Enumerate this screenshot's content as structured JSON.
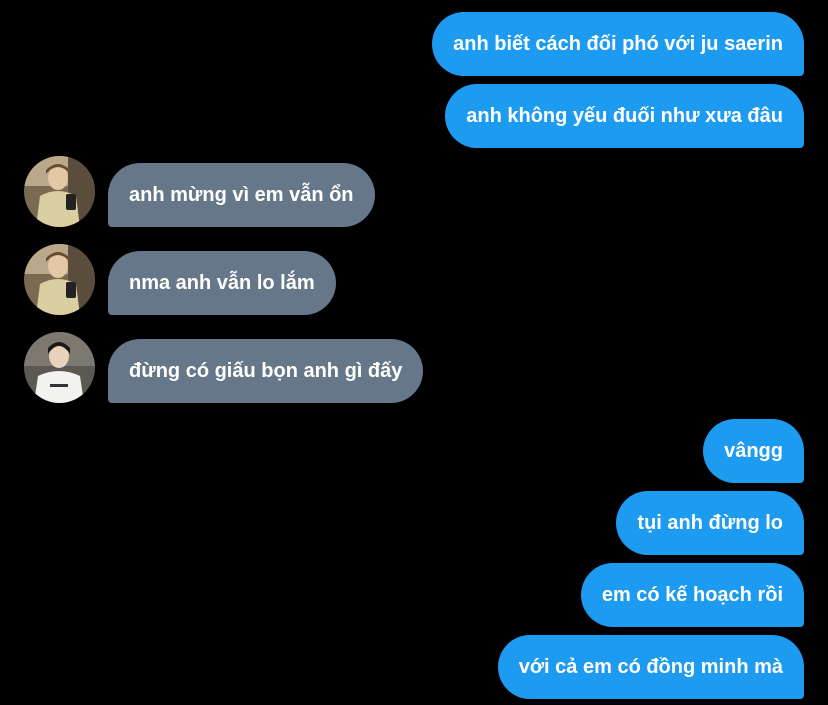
{
  "messages": [
    {
      "text": "anh biết cách đối phó với ju saerin",
      "direction": "outgoing"
    },
    {
      "text": "anh không yếu đuối như xưa đâu",
      "direction": "outgoing"
    },
    {
      "text": "anh mừng vì em vẫn ổn",
      "direction": "incoming",
      "avatar": "avatar-photo-1"
    },
    {
      "text": "nma anh vẫn lo lắm",
      "direction": "incoming",
      "avatar": "avatar-photo-1"
    },
    {
      "text": "đừng có giấu bọn anh gì đấy",
      "direction": "incoming",
      "avatar": "avatar-photo-2"
    },
    {
      "text": "vângg",
      "direction": "outgoing"
    },
    {
      "text": "tụi anh đừng lo",
      "direction": "outgoing"
    },
    {
      "text": "em có kế hoạch rồi",
      "direction": "outgoing"
    },
    {
      "text": "với cả em có đồng minh mà",
      "direction": "outgoing"
    }
  ],
  "colors": {
    "background": "#000000",
    "outgoing_bubble": "#1d9bf0",
    "incoming_bubble": "#66778a",
    "text": "#ffffff"
  }
}
